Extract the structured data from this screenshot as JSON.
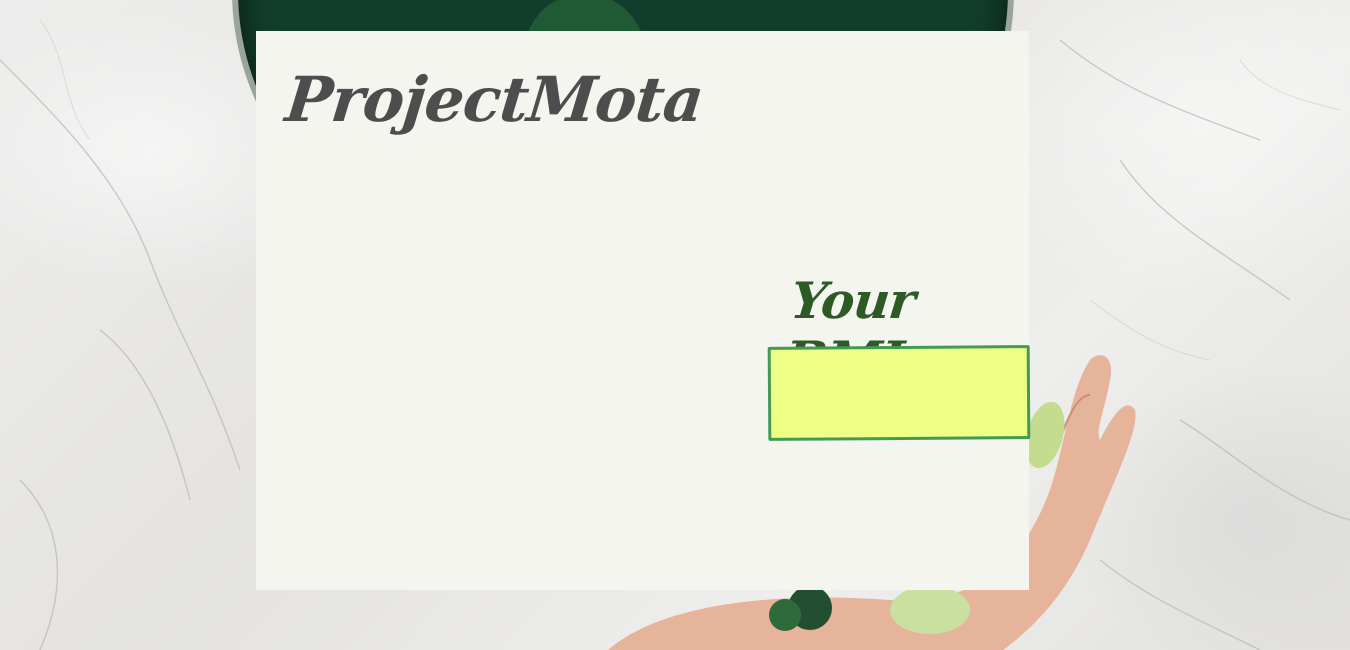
{
  "brand": {
    "name": "ProjectMota"
  },
  "bmi": {
    "label": "Your BMI",
    "value": ""
  },
  "colors": {
    "card_background": "#f4f5ef",
    "brand_text": "#4d4d4d",
    "bmi_label_text": "#2e5a25",
    "bmi_box_fill": "#eeff86",
    "bmi_box_border": "#449a55"
  }
}
